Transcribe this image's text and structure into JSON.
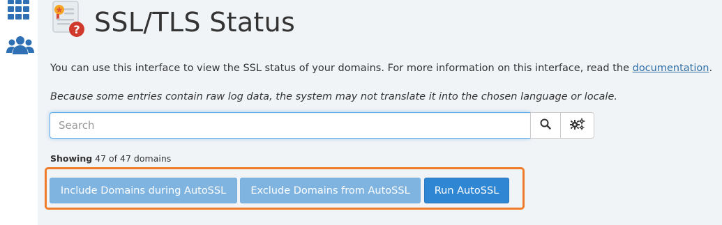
{
  "sidebar": {
    "icons": [
      "apps-grid-icon",
      "users-icon"
    ]
  },
  "header": {
    "icon": "ssl-certificate-question-icon",
    "title": "SSL/TLS Status"
  },
  "intro": {
    "text": "You can use this interface to view the SSL status of your domains. For more information on this interface, read the ",
    "link_label": "documentation",
    "suffix": "."
  },
  "notice": {
    "text": "Because some entries contain raw log data, the system may not translate it into the chosen language or locale."
  },
  "search": {
    "placeholder": "Search",
    "value": "",
    "search_icon": "search-icon",
    "settings_icon": "gears-icon"
  },
  "showing": {
    "label": "Showing",
    "text": "47 of 47 domains"
  },
  "actions": {
    "include_label": "Include Domains during AutoSSL",
    "exclude_label": "Exclude Domains from AutoSSL",
    "run_label": "Run AutoSSL"
  },
  "colors": {
    "primary_button": "#2f86d3",
    "disabled_button": "#7fb3e0",
    "highlight": "#f07b29",
    "link": "#2f6fa6"
  }
}
